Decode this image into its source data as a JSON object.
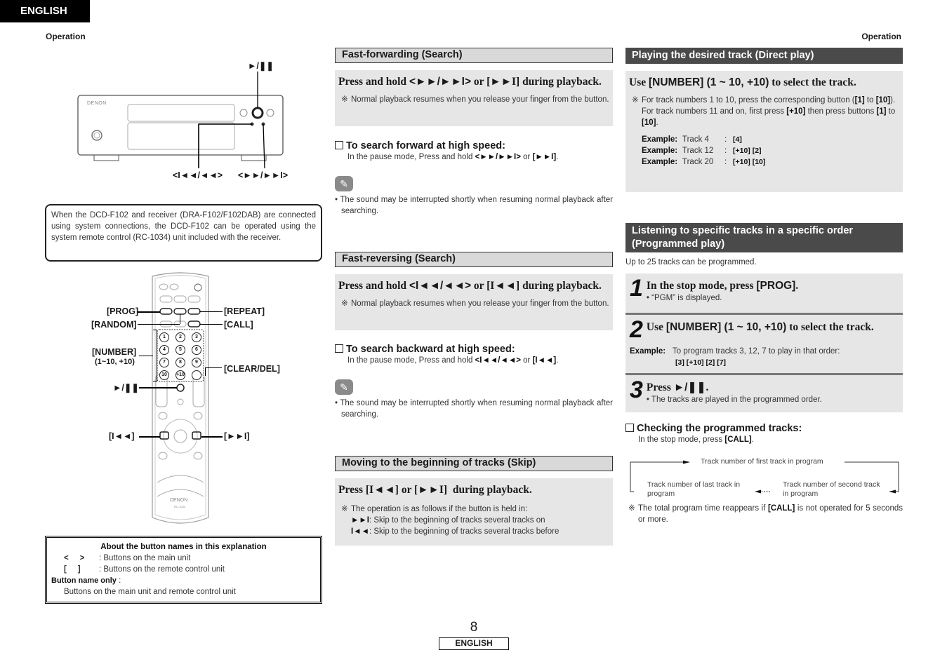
{
  "header": {
    "language_tab": "ENGLISH",
    "running_head_left": "Operation",
    "running_head_right": "Operation"
  },
  "main_unit_figure": {
    "brand": "DENON",
    "callouts": {
      "play_pause": "►/❚❚",
      "prev_rewind": "<I◄◄/◄◄>",
      "ffwd_next": "<►►/►►I>"
    }
  },
  "system_info": "When the DCD-F102 and receiver (DRA-F102/F102DAB) are connected using system connections, the DCD-F102 can be operated using the system remote control (RC-1034) unit included with the receiver.",
  "remote_figure": {
    "brand": "DENON",
    "model": "RC-1034",
    "number_keys": [
      "1",
      "2",
      "3",
      "4",
      "5",
      "6",
      "7",
      "8",
      "9",
      "10",
      "+10"
    ],
    "callouts": {
      "prog": "[PROG]",
      "random": "[RANDOM]",
      "repeat": "[REPEAT]",
      "call": "[CALL]",
      "number": "[NUMBER]",
      "number_range": "(1~10, +10)",
      "clear_del": "[CLEAR/DEL]",
      "play_pause": "►/❚❚",
      "skip_back": "[I◄◄]",
      "skip_fwd": "[►►I]"
    }
  },
  "about_box": {
    "title": "About the button names in this explanation",
    "rows": [
      {
        "symbol": "<     >",
        "desc": ": Buttons on the main unit"
      },
      {
        "symbol": "[     ]",
        "desc": ": Buttons on the remote control unit"
      }
    ],
    "only_label": "Button name only",
    "only_colon": " :",
    "only_desc": "Buttons on the main unit and remote control unit"
  },
  "fast_forward": {
    "heading": "Fast-forwarding (Search)",
    "instruction_pre": "Press and hold ",
    "instruction_main": "<►►/►►I>",
    "instruction_or": " or ",
    "instruction_remote": "[►►I]",
    "instruction_post": " during playback.",
    "note_mark": "※",
    "note": "Normal playback resumes when you release your finger from the button.",
    "sub_heading": "To search forward at high speed:",
    "sub_body_pre": "In the pause mode, Press and hold ",
    "sub_body_main": "<►►/►►I>",
    "sub_body_or": " or ",
    "sub_body_remote": "[►►I]",
    "sub_body_end": ".",
    "tip_icon": "✎",
    "tip": "The sound may be interrupted shortly when resuming normal playback after searching."
  },
  "fast_reverse": {
    "heading": "Fast-reversing (Search)",
    "instruction_pre": "Press and hold ",
    "instruction_main": "<I◄◄/◄◄>",
    "instruction_or": " or ",
    "instruction_remote": "[I◄◄]",
    "instruction_post": " during playback.",
    "note_mark": "※",
    "note": "Normal playback resumes when you release your finger from the button.",
    "sub_heading": "To search backward at high speed:",
    "sub_body_pre": "In the pause mode, Press and hold ",
    "sub_body_main": "<I◄◄/◄◄>",
    "sub_body_or": " or ",
    "sub_body_remote": "[I◄◄]",
    "sub_body_end": ".",
    "tip_icon": "✎",
    "tip": "The sound may be interrupted shortly when resuming normal playback after searching."
  },
  "skip": {
    "heading": "Moving to the beginning of tracks (Skip)",
    "instruction_pre": "Press ",
    "instruction_back": "[I◄◄]",
    "instruction_or": " or ",
    "instruction_fwd": "[►►I]",
    "instruction_post": "  during playback.",
    "note_mark": "※",
    "note": "The operation is as follows if the button is held in:",
    "fwd_symbol": "►►I",
    "fwd_desc": ": Skip to the beginning of tracks several tracks on",
    "back_symbol": "I◄◄",
    "back_desc": ": Skip to the beginning of tracks several tracks before"
  },
  "direct_play": {
    "heading": "Playing the desired track (Direct play)",
    "instruction_pre": "Use ",
    "instruction_key": "[NUMBER] (1 ~ 10, +10)",
    "instruction_post": " to select the track.",
    "note_mark": "※",
    "note_a_pre": "For track numbers 1 to 10, press the corresponding button (",
    "note_a_k1": "[1]",
    "note_a_mid": " to ",
    "note_a_k2": "[10]",
    "note_a_end": ").",
    "note_b_pre": "For track numbers 11 and on, first press ",
    "note_b_k1": "[+10]",
    "note_b_mid": " then press buttons ",
    "note_b_k2": "[1]",
    "note_b_to": " to ",
    "note_b_k3": "[10]",
    "note_b_end": ".",
    "examples": [
      {
        "label": "Example:",
        "track": "Track 4",
        "keys": "[4]"
      },
      {
        "label": "Example:",
        "track": "Track 12",
        "keys": "[+10] [2]"
      },
      {
        "label": "Example:",
        "track": "Track 20",
        "keys": "[+10] [10]"
      }
    ]
  },
  "programmed_play": {
    "heading_line1": "Listening to specific tracks in a specific order",
    "heading_line2": "(Programmed play)",
    "intro": "Up to 25 tracks can be programmed.",
    "steps": [
      {
        "num": "1",
        "title_pre": "In the stop mode, press ",
        "title_key": "[PROG]",
        "title_post": ".",
        "sub": "• “PGM” is displayed."
      },
      {
        "num": "2",
        "title_pre": "Use ",
        "title_key": "[NUMBER] (1 ~ 10, +10)",
        "title_post": " to select the track.",
        "example_label": "Example:",
        "example_text": "To program tracks 3, 12, 7 to play in that order:",
        "example_keys": "[3] [+10] [2] [7]"
      },
      {
        "num": "3",
        "title_pre": "Press ",
        "title_key": "►/❚❚",
        "title_post": ".",
        "sub": "• The tracks are played in the programmed order."
      }
    ],
    "check_heading": "Checking the programmed tracks:",
    "check_body_pre": "In the stop mode, press ",
    "check_body_key": "[CALL]",
    "check_body_end": ".",
    "cycle": {
      "first": "Track number of first track in program",
      "second": "Track number of second track in program",
      "last": "Track number of last track in program"
    },
    "note_mark": "※",
    "note_pre": "The total program time reappears if ",
    "note_key": "[CALL]",
    "note_post": " is not operated for 5 seconds or more."
  },
  "footer": {
    "page_number": "8",
    "language": "ENGLISH"
  }
}
